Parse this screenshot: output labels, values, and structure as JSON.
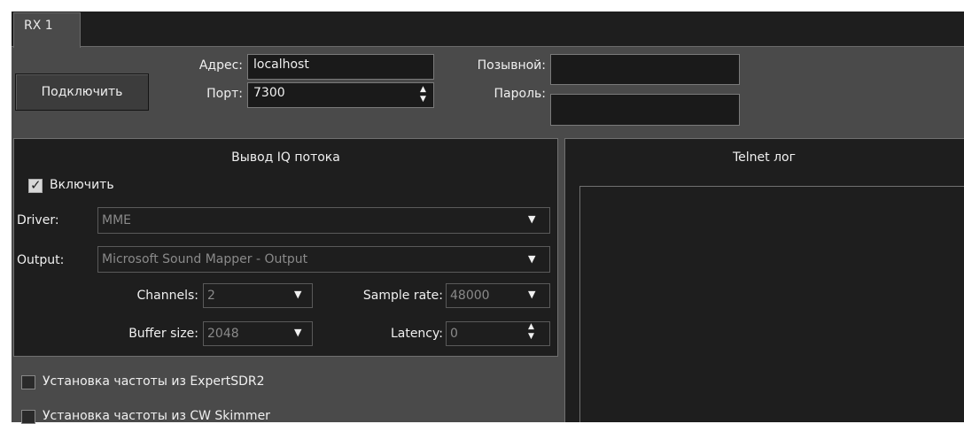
{
  "tabs": [
    {
      "label": "RX 1"
    }
  ],
  "connection": {
    "connect_label": "Подключить",
    "address_label": "Адрес:",
    "address_value": "localhost",
    "port_label": "Порт:",
    "port_value": "7300",
    "callsign_label": "Позывной:",
    "callsign_value": "",
    "password_label": "Пароль:",
    "password_value": ""
  },
  "iq_output": {
    "title": "Вывод IQ потока",
    "enable_label": "Включить",
    "enable_checked": true,
    "driver_label": "Driver:",
    "driver_value": "MME",
    "output_label": "Output:",
    "output_value": "Microsoft Sound Mapper - Output",
    "channels_label": "Channels:",
    "channels_value": "2",
    "sample_rate_label": "Sample rate:",
    "sample_rate_value": "48000",
    "buffer_size_label": "Buffer size:",
    "buffer_size_value": "2048",
    "latency_label": "Latency:",
    "latency_value": "0"
  },
  "options": {
    "freq_expertsdr_label": "Установка частоты из ExpertSDR2",
    "freq_skimmer_label": "Установка частоты из CW Skimmer"
  },
  "telnet": {
    "title": "Telnet лог",
    "log_text": ""
  },
  "colors": {
    "panel_bg": "#4a4a4a",
    "group_bg": "#1e1e1e",
    "field_bg": "#1a1a1a",
    "text": "#f0f0f0",
    "disabled_text": "#8a8a8a"
  }
}
